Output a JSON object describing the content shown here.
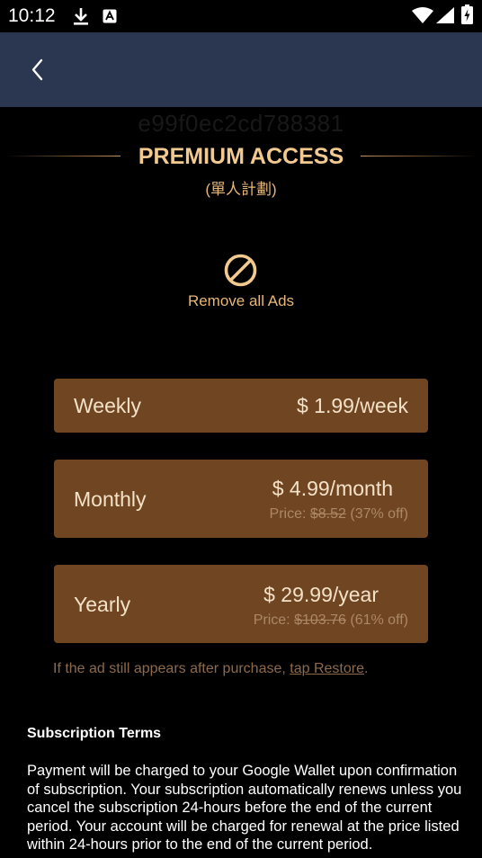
{
  "status_bar": {
    "time": "10:12",
    "icons": [
      "download-icon",
      "notification-a-icon",
      "wifi-icon",
      "signal-icon",
      "battery-charging-icon"
    ]
  },
  "app_bar": {
    "back_icon": "chevron-left-icon"
  },
  "hash_text": "e99f0ec2cd788381",
  "header": {
    "title": "PREMIUM ACCESS",
    "subtitle": "(單人計劃)"
  },
  "feature": {
    "icon": "no-ads-icon",
    "label": "Remove all Ads"
  },
  "plans": [
    {
      "name": "Weekly",
      "price": "$ 1.99/week"
    },
    {
      "name": "Monthly",
      "price": "$ 4.99/month",
      "price_label": "Price:",
      "original_price": "$8.52",
      "discount": "(37% off)"
    },
    {
      "name": "Yearly",
      "price": "$ 29.99/year",
      "price_label": "Price:",
      "original_price": "$103.76",
      "discount": "(61% off)"
    }
  ],
  "restore": {
    "text": "If the ad still appears after purchase, ",
    "link": "tap Restore",
    "end": "."
  },
  "terms": {
    "title": "Subscription Terms",
    "body": "Payment will be charged to your Google Wallet upon confirmation of subscription. Your subscription automatically renews unless you cancel the subscription 24-hours before the end of the current period. Your account will be charged for renewal at the price listed within 24-hours prior to the end of the current period."
  },
  "colors": {
    "accent": "#f2c98f",
    "plan_bg": "#6f4522",
    "app_bar": "#2b3650"
  }
}
